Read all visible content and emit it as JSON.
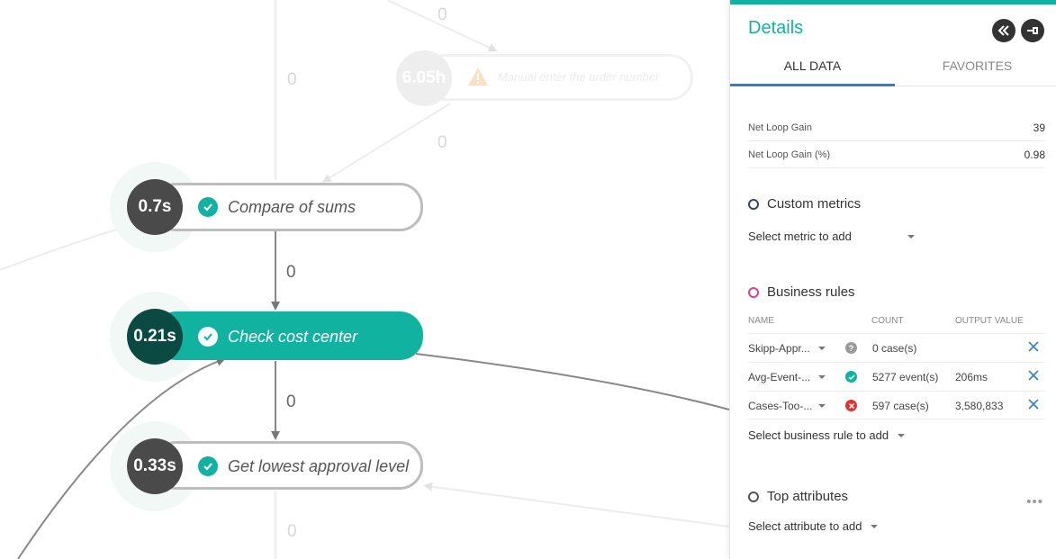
{
  "canvas": {
    "edge_labels": [
      "0",
      "0",
      "0",
      "0",
      "0",
      "0"
    ],
    "nodes": [
      {
        "duration": "6.05h",
        "label": "Manual enter the order number"
      },
      {
        "duration": "0.7s",
        "label": "Compare of sums"
      },
      {
        "duration": "0.21s",
        "label": "Check cost center"
      },
      {
        "duration": "0.33s",
        "label": "Get lowest approval level"
      }
    ]
  },
  "panel": {
    "title": "Details",
    "collapse_icon": "double-chevron-left-icon",
    "pin_icon": "pin-icon",
    "tabs": [
      {
        "label": "ALL DATA",
        "active": true
      },
      {
        "label": "FAVORITES",
        "active": false
      }
    ],
    "metrics": [
      {
        "label": "Net Loop Gain",
        "value": "39"
      },
      {
        "label": "Net Loop Gain (%)",
        "value": "0.98"
      }
    ],
    "custom_metrics": {
      "title": "Custom metrics",
      "select_label": "Select metric to add"
    },
    "business_rules": {
      "title": "Business rules",
      "columns": {
        "name": "NAME",
        "count": "COUNT",
        "output": "OUTPUT VALUE"
      },
      "rows": [
        {
          "name": "Skipp-Appr...",
          "status": "unknown",
          "count": "0 case(s)",
          "output": ""
        },
        {
          "name": "Avg-Event-...",
          "status": "ok",
          "count": "5277 event(s)",
          "output": "206ms"
        },
        {
          "name": "Cases-Too-...",
          "status": "error",
          "count": "597 case(s)",
          "output": "3,580,833"
        }
      ],
      "select_label": "Select business rule to add"
    },
    "top_attributes": {
      "title": "Top attributes",
      "more": "•••",
      "select_label": "Select attribute to add"
    },
    "colors": {
      "accent": "#11b3a0",
      "tab_underline": "#2f80c9",
      "business_rules_ring": "#e0408e",
      "error": "#e03030",
      "remove": "#2f80c9"
    }
  }
}
